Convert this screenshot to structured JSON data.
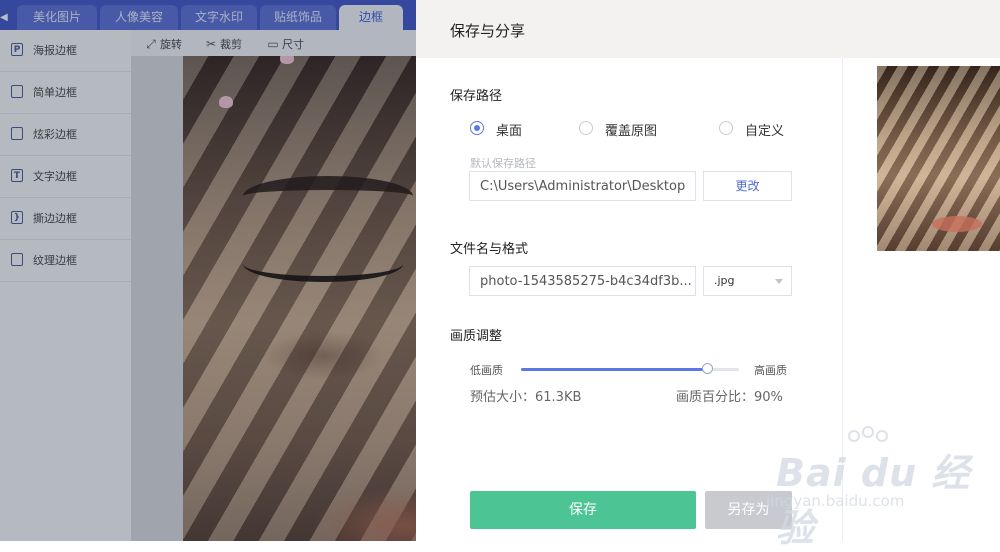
{
  "editor": {
    "tabs": [
      "美化图片",
      "人像美容",
      "文字水印",
      "贴纸饰品",
      "边框"
    ],
    "active_tab": "边框",
    "sidebar": [
      {
        "label": "海报边框",
        "icon": "poster-frame-icon",
        "glyph": "P"
      },
      {
        "label": "简单边框",
        "icon": "simple-frame-icon",
        "glyph": ""
      },
      {
        "label": "炫彩边框",
        "icon": "colorful-frame-icon",
        "glyph": ""
      },
      {
        "label": "文字边框",
        "icon": "text-frame-icon",
        "glyph": "T"
      },
      {
        "label": "撕边边框",
        "icon": "torn-frame-icon",
        "glyph": "}"
      },
      {
        "label": "纹理边框",
        "icon": "texture-frame-icon",
        "glyph": ""
      }
    ],
    "tools": {
      "rotate": "旋转",
      "crop": "裁剪",
      "size": "尺寸"
    }
  },
  "dialog": {
    "title": "保存与分享",
    "save_path": {
      "heading": "保存路径",
      "options": [
        {
          "label": "桌面",
          "checked": true
        },
        {
          "label": "覆盖原图",
          "checked": false
        },
        {
          "label": "自定义",
          "checked": false
        }
      ],
      "hint": "默认保存路径",
      "path_value": "C:\\Users\\Administrator\\Desktop",
      "change_button": "更改"
    },
    "file": {
      "heading": "文件名与格式",
      "name_value": "photo-1543585275-b4c34df3b...",
      "format": ".jpg"
    },
    "quality": {
      "heading": "画质调整",
      "low_label": "低画质",
      "high_label": "高画质",
      "level": 0.86,
      "estimate": "预估大小：61.3KB",
      "percent": "画质百分比：90%"
    },
    "buttons": {
      "save": "保存",
      "save_as": "另存为"
    }
  },
  "watermark": {
    "main": "Bai du 经验",
    "sub": "jingyan.baidu.com"
  },
  "colors": {
    "primary_green": "#4cc494",
    "accent_blue": "#5b78e6",
    "tab_bar": "#3f56c8"
  }
}
